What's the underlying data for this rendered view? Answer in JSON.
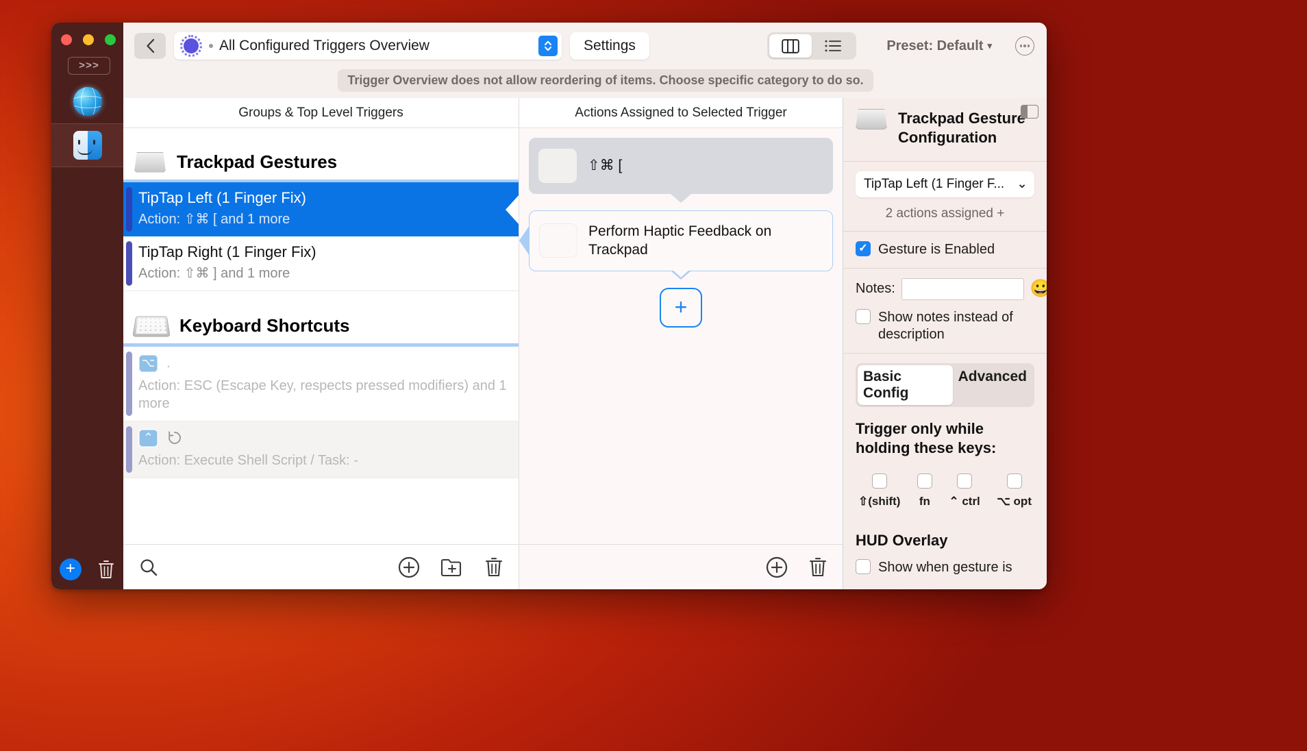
{
  "toolbar": {
    "back_icon": "chevron-left-icon",
    "title": "All Configured Triggers Overview",
    "settings_label": "Settings",
    "preset_label": "Preset: Default",
    "preset_caret": "▾",
    "view_columns_icon": "columns-view-icon",
    "view_list_icon": "list-view-icon",
    "more_icon": "ellipsis-circle-icon"
  },
  "notice": {
    "text": "Trigger Overview does not allow reordering of items. Choose specific category to do so."
  },
  "left_panel": {
    "header": "Groups & Top Level Triggers",
    "groups": [
      {
        "icon": "trackpad-icon",
        "title": "Trackpad Gestures",
        "items": [
          {
            "name": "TipTap Left (1 Finger Fix)",
            "sub": "Action: ⇧⌘ [ and 1 more",
            "selected": true
          },
          {
            "name": "TipTap Right (1 Finger Fix)",
            "sub": "Action: ⇧⌘ ] and 1 more",
            "selected": false
          }
        ]
      },
      {
        "icon": "keyboard-icon",
        "title": "Keyboard Shortcuts",
        "items": [
          {
            "keycap": "⌥",
            "name": ".",
            "sub": "Action: ESC (Escape Key, respects pressed modifiers) and 1 more",
            "dim": true
          },
          {
            "keycap": "⌃",
            "extra_icon": "repeat-clock-icon",
            "name": "",
            "sub": "Action: Execute Shell Script / Task: -",
            "dim": true,
            "shaded": true
          }
        ]
      }
    ],
    "footer": {
      "search_icon": "search-icon",
      "add_icon": "add-circle-icon",
      "new_folder_icon": "new-folder-icon",
      "delete_icon": "trash-icon"
    }
  },
  "mid_panel": {
    "header": "Actions Assigned to Selected Trigger",
    "actions": [
      {
        "label": "⇧⌘ [",
        "style": "grey"
      },
      {
        "label": "Perform Haptic Feedback on Trackpad",
        "style": "outline"
      }
    ],
    "add_button": "+",
    "footer": {
      "add_icon": "add-circle-icon",
      "delete_icon": "trash-icon"
    }
  },
  "right_panel": {
    "icon": "trackpad-icon",
    "title": "Trackpad Gesture Configuration",
    "panel_toggle_icon": "sidebar-toggle-icon",
    "trigger_select": "TipTap Left (1 Finger F...",
    "select_caret": "⌄",
    "actions_assigned": "2 actions assigned +",
    "gesture_enabled": {
      "label": "Gesture is Enabled",
      "checked": true
    },
    "notes": {
      "label": "Notes:",
      "value": "",
      "placeholder": "",
      "emoji": "😀"
    },
    "show_notes": {
      "label": "Show notes instead of description",
      "checked": false
    },
    "tabs": [
      {
        "label": "Basic Config",
        "active": true
      },
      {
        "label": "Advanced",
        "active": false
      }
    ],
    "trigger_keys_heading": "Trigger only while holding these keys:",
    "modifiers": [
      {
        "label": "⇧(shift)",
        "checked": false
      },
      {
        "label": "fn",
        "checked": false
      },
      {
        "label": "⌃ ctrl",
        "checked": false
      },
      {
        "label": "⌥ opt",
        "checked": false
      }
    ],
    "hud_heading": "HUD Overlay",
    "hud_option": {
      "label": "Show when gesture is",
      "checked": false
    }
  },
  "colors": {
    "accent_blue": "#0b74e5",
    "selection_blue": "#1a84f5",
    "window_bg": "#f6f0ee",
    "rail_bg": "#4a1f1c"
  }
}
